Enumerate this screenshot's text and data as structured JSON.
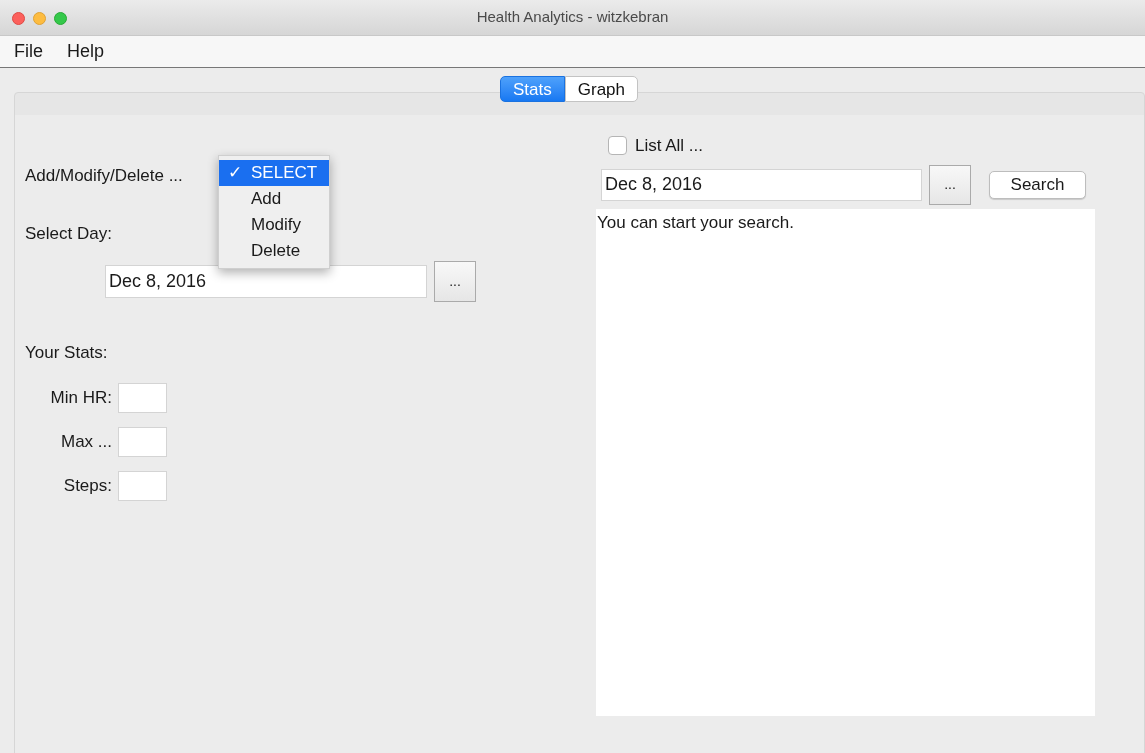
{
  "window": {
    "title": "Health Analytics - witzkebran"
  },
  "menu": [
    "File",
    "Help"
  ],
  "tabs": [
    {
      "label": "Stats",
      "selected": true
    },
    {
      "label": "Graph",
      "selected": false
    }
  ],
  "left": {
    "action_label": "Add/Modify/Delete ...",
    "action_menu": [
      {
        "label": "SELECT",
        "selected": true
      },
      {
        "label": "Add",
        "selected": false
      },
      {
        "label": "Modify",
        "selected": false
      },
      {
        "label": "Delete",
        "selected": false
      }
    ],
    "check_mark": "✓",
    "day_label": "Select Day:",
    "day_value": "Dec 8, 2016",
    "day_button": "...",
    "stats_label": "Your Stats:",
    "stats": [
      {
        "label": "Min HR:"
      },
      {
        "label": "Max ..."
      },
      {
        "label": "Steps:"
      }
    ]
  },
  "right": {
    "list_all": {
      "label": "List All ...",
      "checked": false
    },
    "date_value": "Dec 8, 2016",
    "date_button": "...",
    "search_button": "Search",
    "results_text": "You can start your search."
  }
}
